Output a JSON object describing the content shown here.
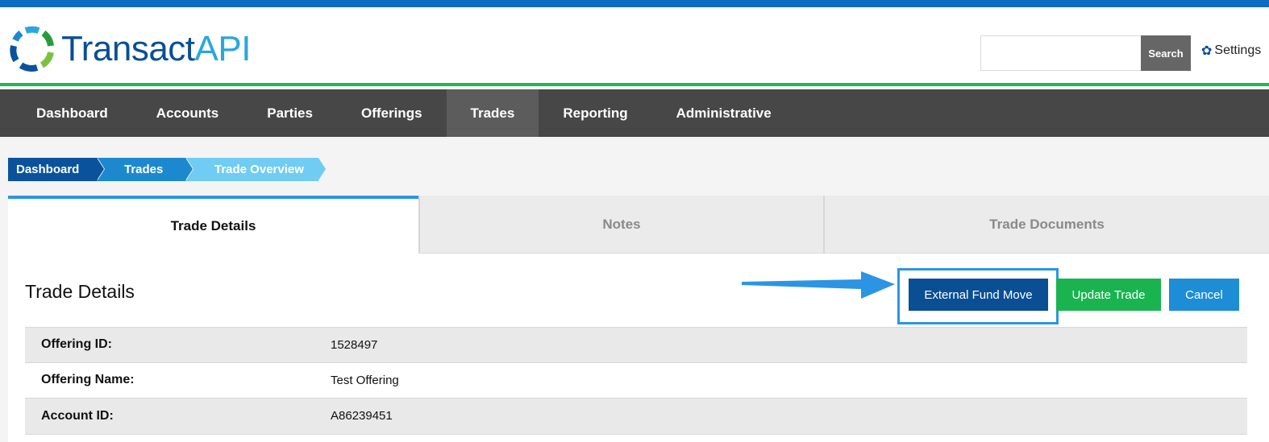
{
  "header": {
    "logo": {
      "text_main": "Transact",
      "text_accent": "API"
    },
    "search": {
      "value": "",
      "placeholder": "",
      "button_label": "Search"
    },
    "settings": {
      "icon": "gear-icon",
      "label": "Settings"
    }
  },
  "nav": {
    "items": [
      {
        "label": "Dashboard",
        "active": false
      },
      {
        "label": "Accounts",
        "active": false
      },
      {
        "label": "Parties",
        "active": false
      },
      {
        "label": "Offerings",
        "active": false
      },
      {
        "label": "Trades",
        "active": true
      },
      {
        "label": "Reporting",
        "active": false
      },
      {
        "label": "Administrative",
        "active": false
      }
    ]
  },
  "breadcrumb": [
    {
      "label": "Dashboard"
    },
    {
      "label": "Trades"
    },
    {
      "label": "Trade Overview"
    }
  ],
  "tabs": [
    {
      "label": "Trade Details",
      "active": true
    },
    {
      "label": "Notes",
      "active": false
    },
    {
      "label": "Trade Documents",
      "active": false
    }
  ],
  "main": {
    "section_title": "Trade Details",
    "buttons": {
      "external_fund_move": "External Fund Move",
      "update_trade": "Update Trade",
      "cancel": "Cancel"
    },
    "details": [
      {
        "label": "Offering ID:",
        "value": "1528497"
      },
      {
        "label": "Offering Name:",
        "value": "Test Offering"
      },
      {
        "label": "Account ID:",
        "value": "A86239451"
      }
    ]
  },
  "colors": {
    "brand_dark_blue": "#0a4f93",
    "brand_light_blue": "#29a6e0",
    "brand_green": "#1fb74f",
    "nav_bg": "#474747",
    "annotation_blue": "#2b95e4"
  }
}
